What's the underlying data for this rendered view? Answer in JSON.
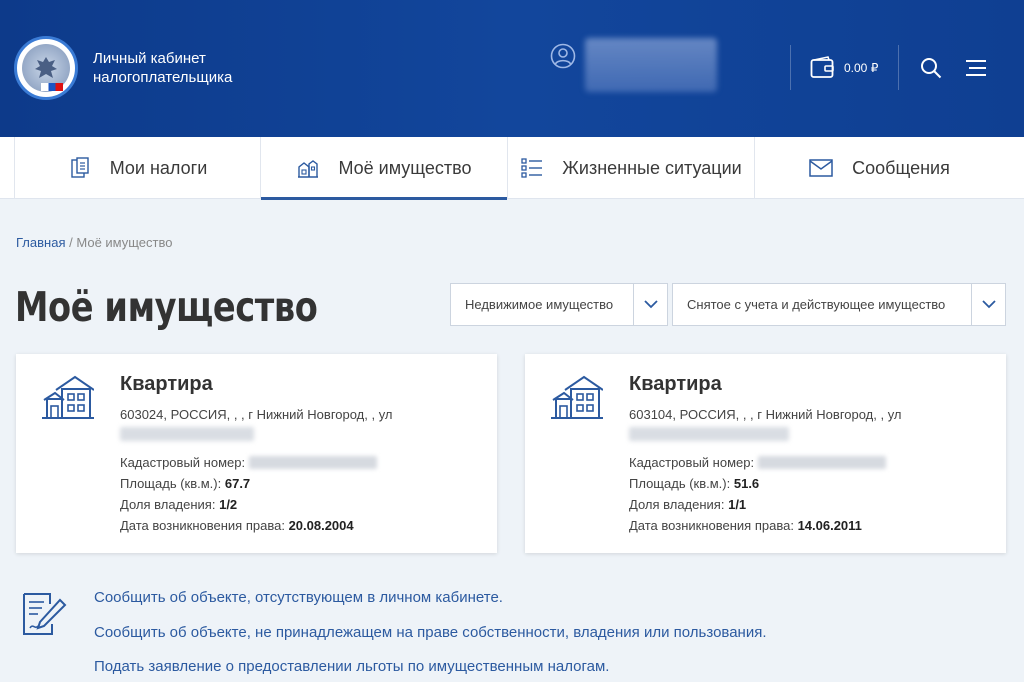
{
  "header": {
    "brand_line1": "Личный кабинет",
    "brand_line2": "налогоплательщика",
    "balance": "0.00 ₽"
  },
  "nav": {
    "items": [
      {
        "label": "Мои налоги",
        "icon": "tax-document-icon"
      },
      {
        "label": "Моё имущество",
        "icon": "property-icon"
      },
      {
        "label": "Жизненные ситуации",
        "icon": "list-icon"
      },
      {
        "label": "Сообщения",
        "icon": "envelope-icon"
      }
    ],
    "active": "Моё имущество"
  },
  "breadcrumb": {
    "home": "Главная",
    "separator": "/",
    "current": "Моё имущество"
  },
  "page_title": "Моё имущество",
  "filters": {
    "type_selected": "Недвижимое имущество",
    "status_selected": "Снятое с учета и действующее имущество"
  },
  "cards": [
    {
      "title": "Квартира",
      "address": "603024, РОССИЯ, , , г Нижний Новгород, , ул",
      "kad_label": "Кадастровый номер:",
      "area_label": "Площадь (кв.м.):",
      "area": "67.7",
      "share_label": "Доля владения:",
      "share": "1/2",
      "date_label": "Дата возникновения права:",
      "date": "20.08.2004"
    },
    {
      "title": "Квартира",
      "address": "603104, РОССИЯ, , , г Нижний Новгород, , ул",
      "kad_label": "Кадастровый номер:",
      "area_label": "Площадь (кв.м.):",
      "area": "51.6",
      "share_label": "Доля владения:",
      "share": "1/1",
      "date_label": "Дата возникновения права:",
      "date": "14.06.2011"
    }
  ],
  "links": [
    "Сообщить об объекте, отсутствующем в личном кабинете.",
    "Сообщить об объекте, не принадлежащем на праве собственности, владения или пользования.",
    "Подать заявление о предоставлении льготы по имущественным налогам."
  ],
  "colors": {
    "header": "#12469c",
    "accent": "#2c5aa0",
    "background": "#eef3f8"
  }
}
